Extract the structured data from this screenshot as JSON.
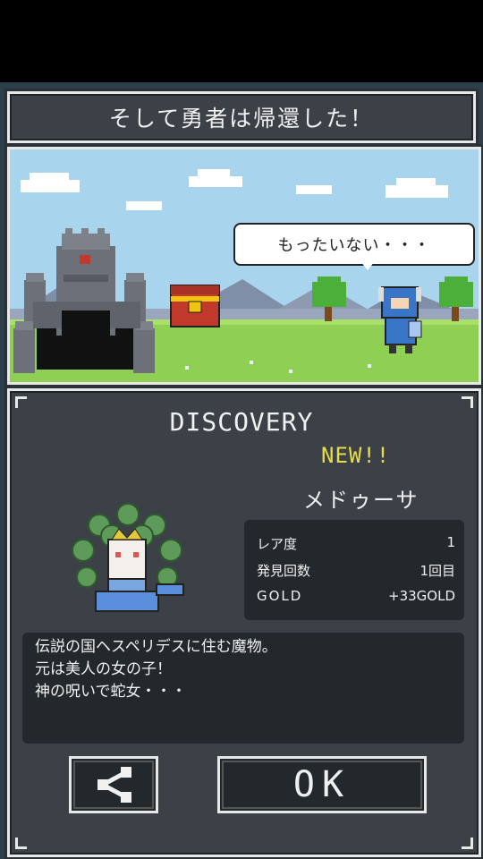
{
  "header": {
    "title": "そして勇者は帰還した！"
  },
  "scene": {
    "speech": "もったいない・・・"
  },
  "discovery": {
    "heading": "DISCOVERY",
    "new_label": "NEW!!",
    "monster_name": "メドゥーサ",
    "stats": [
      {
        "label": "レア度",
        "value": "1"
      },
      {
        "label": "発見回数",
        "value": "1回目"
      },
      {
        "label": "GOLD",
        "value": "+33GOLD"
      }
    ],
    "description": [
      "伝説の国ヘスペリデスに住む魔物。",
      "元は美人の女の子！",
      "神の呪いで蛇女・・・"
    ]
  },
  "buttons": {
    "ok_label": "OK",
    "share_icon": "share-icon"
  }
}
